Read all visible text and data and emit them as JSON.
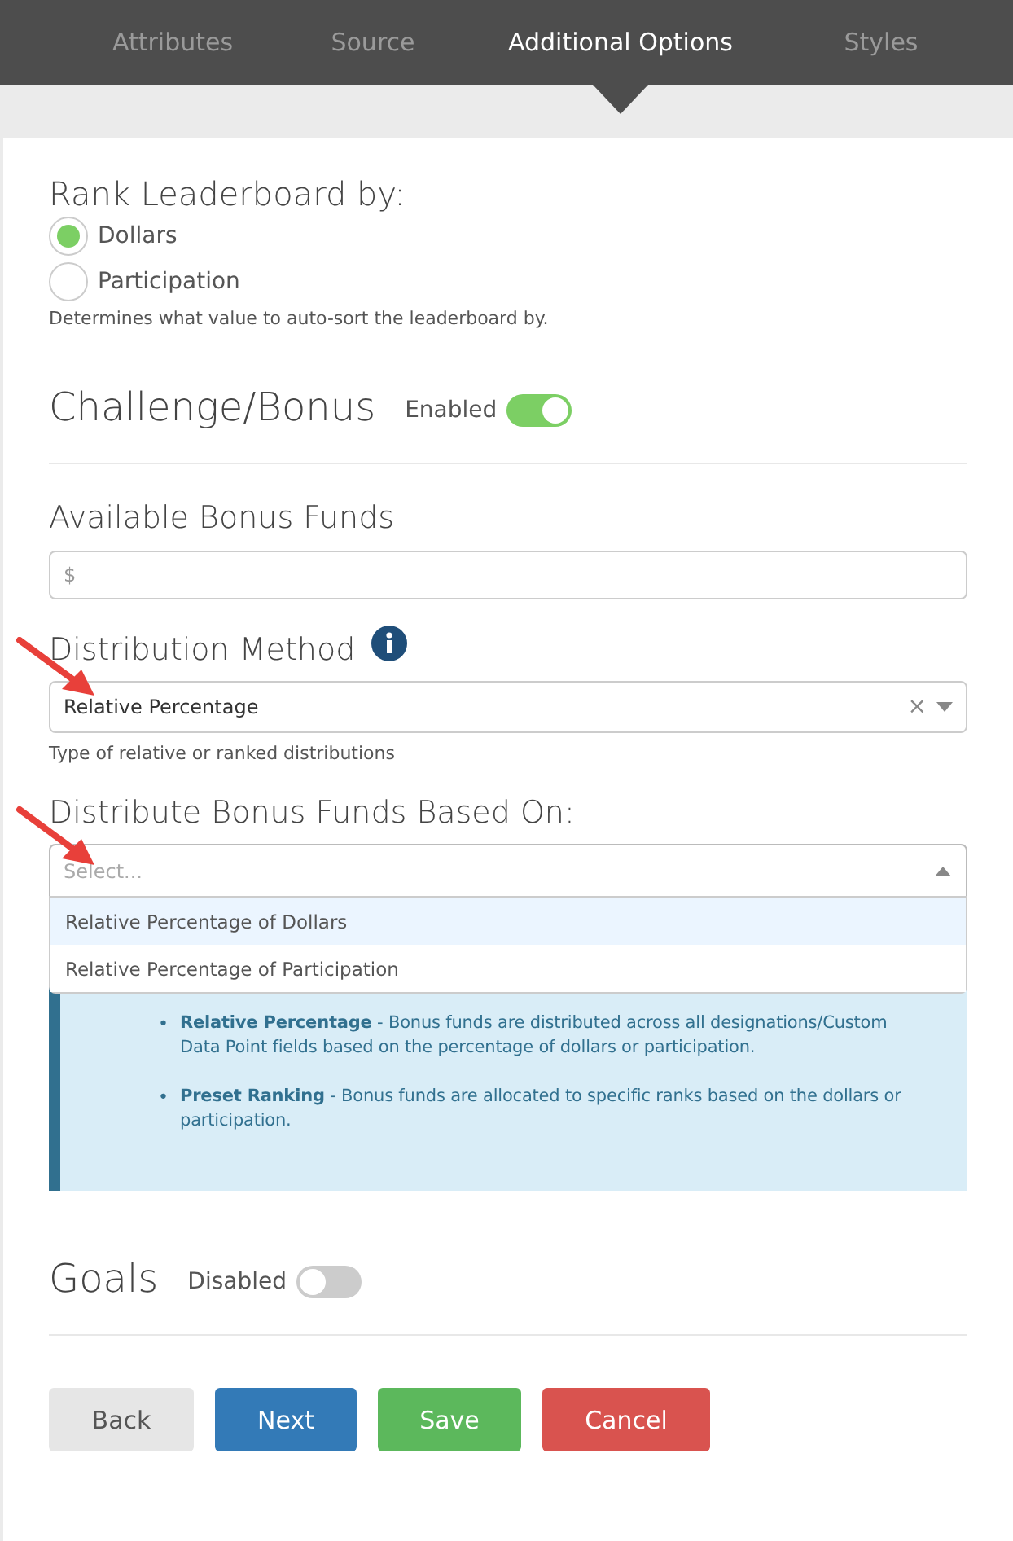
{
  "tabs": [
    {
      "label": "Attributes",
      "selected": false
    },
    {
      "label": "Source",
      "selected": false
    },
    {
      "label": "Additional Options",
      "selected": true
    },
    {
      "label": "Styles",
      "selected": false
    }
  ],
  "rank": {
    "title": "Rank Leaderboard by:",
    "options": [
      {
        "label": "Dollars",
        "selected": true
      },
      {
        "label": "Participation",
        "selected": false
      }
    ],
    "help": "Determines what value to auto-sort the leaderboard by."
  },
  "challenge": {
    "title": "Challenge/Bonus",
    "status": "Enabled",
    "on": true
  },
  "bonus_funds": {
    "label": "Available Bonus Funds",
    "placeholder": "$"
  },
  "distribution": {
    "label": "Distribution Method",
    "value": "Relative Percentage",
    "clear": "×",
    "help": "Type of relative or ranked distributions"
  },
  "based_on": {
    "label": "Distribute Bonus Funds Based On:",
    "placeholder": "Select...",
    "options": [
      {
        "label": "Relative Percentage of Dollars",
        "selected": true
      },
      {
        "label": "Relative Percentage of Participation",
        "selected": false
      }
    ]
  },
  "info": {
    "bullet": "•",
    "items": [
      "**Relative Percentage** - Bonus funds are distributed across all designations/Custom Data Point fields based on the percentage of dollars or participation.",
      "**Preset Ranking** - Bonus funds are allocated to specific ranks based on the dollars or participation."
    ]
  },
  "goals": {
    "title": "Goals",
    "status": "Disabled",
    "on": false
  },
  "buttons": [
    {
      "label": "Back",
      "kind": "default"
    },
    {
      "label": "Next",
      "kind": "primary"
    },
    {
      "label": "Save",
      "kind": "success"
    },
    {
      "label": "Cancel",
      "kind": "danger"
    }
  ]
}
